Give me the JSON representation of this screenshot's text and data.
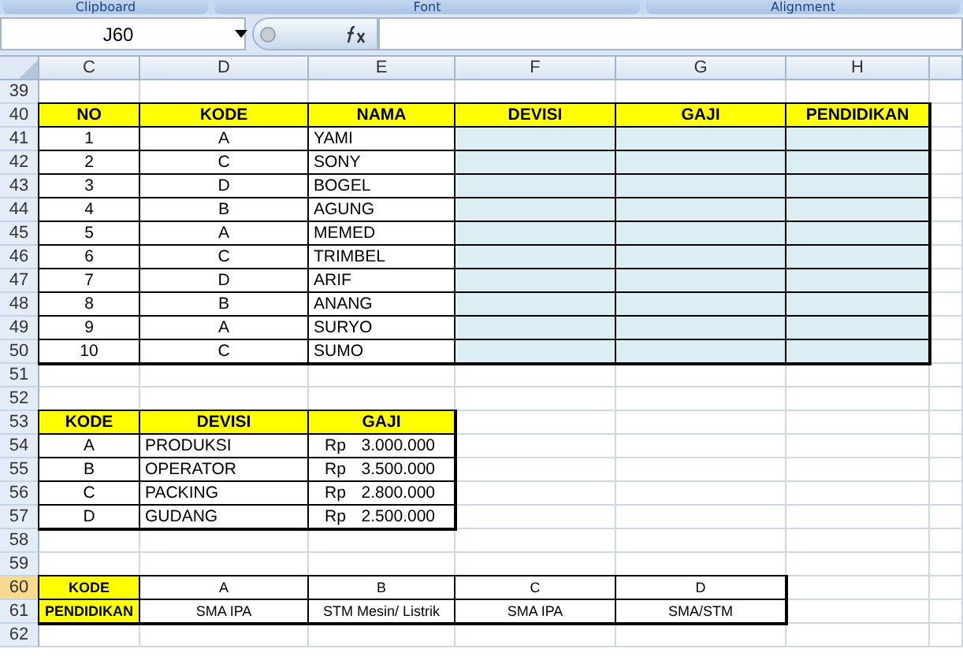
{
  "ribbon_groups": [
    "Clipboard",
    "Font",
    "Alignment"
  ],
  "name_box": "J60",
  "columns": [
    {
      "label": "C",
      "selected": false
    },
    {
      "label": "D",
      "selected": false
    },
    {
      "label": "E",
      "selected": false
    },
    {
      "label": "F",
      "selected": false
    },
    {
      "label": "G",
      "selected": false
    },
    {
      "label": "H",
      "selected": false
    }
  ],
  "rows": [
    {
      "number": "39",
      "selected": false,
      "cells": [
        {
          "kind": "blank"
        },
        {
          "kind": "blank"
        },
        {
          "kind": "blank"
        },
        {
          "kind": "blank"
        },
        {
          "kind": "blank"
        },
        {
          "kind": "blank"
        }
      ]
    },
    {
      "number": "40",
      "selected": false,
      "cells": [
        {
          "kind": "header",
          "text": "NO"
        },
        {
          "kind": "header",
          "text": "KODE"
        },
        {
          "kind": "header",
          "text": "NAMA"
        },
        {
          "kind": "header",
          "text": "DEVISI"
        },
        {
          "kind": "header",
          "text": "GAJI"
        },
        {
          "kind": "header",
          "text": "PENDIDIKAN"
        }
      ]
    },
    {
      "number": "41",
      "selected": false,
      "cells": [
        {
          "kind": "center",
          "text": "1"
        },
        {
          "kind": "center",
          "text": "A"
        },
        {
          "kind": "left",
          "text": "YAMI"
        },
        {
          "kind": "input"
        },
        {
          "kind": "input"
        },
        {
          "kind": "input"
        }
      ]
    },
    {
      "number": "42",
      "selected": false,
      "cells": [
        {
          "kind": "center",
          "text": "2"
        },
        {
          "kind": "center",
          "text": "C"
        },
        {
          "kind": "left",
          "text": "SONY"
        },
        {
          "kind": "input"
        },
        {
          "kind": "input"
        },
        {
          "kind": "input"
        }
      ]
    },
    {
      "number": "43",
      "selected": false,
      "cells": [
        {
          "kind": "center",
          "text": "3"
        },
        {
          "kind": "center",
          "text": "D"
        },
        {
          "kind": "left",
          "text": "BOGEL"
        },
        {
          "kind": "input"
        },
        {
          "kind": "input"
        },
        {
          "kind": "input"
        }
      ]
    },
    {
      "number": "44",
      "selected": false,
      "cells": [
        {
          "kind": "center",
          "text": "4"
        },
        {
          "kind": "center",
          "text": "B"
        },
        {
          "kind": "left",
          "text": "AGUNG"
        },
        {
          "kind": "input"
        },
        {
          "kind": "input"
        },
        {
          "kind": "input"
        }
      ]
    },
    {
      "number": "45",
      "selected": false,
      "cells": [
        {
          "kind": "center",
          "text": "5"
        },
        {
          "kind": "center",
          "text": "A"
        },
        {
          "kind": "left",
          "text": "MEMED"
        },
        {
          "kind": "input"
        },
        {
          "kind": "input"
        },
        {
          "kind": "input"
        }
      ]
    },
    {
      "number": "46",
      "selected": false,
      "cells": [
        {
          "kind": "center",
          "text": "6"
        },
        {
          "kind": "center",
          "text": "C"
        },
        {
          "kind": "left",
          "text": "TRIMBEL"
        },
        {
          "kind": "input"
        },
        {
          "kind": "input"
        },
        {
          "kind": "input"
        }
      ]
    },
    {
      "number": "47",
      "selected": false,
      "cells": [
        {
          "kind": "center",
          "text": "7"
        },
        {
          "kind": "center",
          "text": "D"
        },
        {
          "kind": "left",
          "text": "ARIF"
        },
        {
          "kind": "input"
        },
        {
          "kind": "input"
        },
        {
          "kind": "input"
        }
      ]
    },
    {
      "number": "48",
      "selected": false,
      "cells": [
        {
          "kind": "center",
          "text": "8"
        },
        {
          "kind": "center",
          "text": "B"
        },
        {
          "kind": "left",
          "text": "ANANG"
        },
        {
          "kind": "input"
        },
        {
          "kind": "input"
        },
        {
          "kind": "input"
        }
      ]
    },
    {
      "number": "49",
      "selected": false,
      "cells": [
        {
          "kind": "center",
          "text": "9"
        },
        {
          "kind": "center",
          "text": "A"
        },
        {
          "kind": "left",
          "text": "SURYO"
        },
        {
          "kind": "input"
        },
        {
          "kind": "input"
        },
        {
          "kind": "input"
        }
      ]
    },
    {
      "number": "50",
      "selected": false,
      "cells": [
        {
          "kind": "center",
          "text": "10"
        },
        {
          "kind": "center",
          "text": "C"
        },
        {
          "kind": "left",
          "text": "SUMO"
        },
        {
          "kind": "input"
        },
        {
          "kind": "input"
        },
        {
          "kind": "input"
        }
      ]
    },
    {
      "number": "51",
      "selected": false,
      "cells": [
        {
          "kind": "blank"
        },
        {
          "kind": "blank"
        },
        {
          "kind": "blank"
        },
        {
          "kind": "blank"
        },
        {
          "kind": "blank"
        },
        {
          "kind": "blank"
        }
      ]
    },
    {
      "number": "52",
      "selected": false,
      "cells": [
        {
          "kind": "blank"
        },
        {
          "kind": "blank"
        },
        {
          "kind": "blank"
        },
        {
          "kind": "blank"
        },
        {
          "kind": "blank"
        },
        {
          "kind": "blank"
        }
      ]
    },
    {
      "number": "53",
      "selected": false,
      "cells": [
        {
          "kind": "header",
          "text": "KODE"
        },
        {
          "kind": "header",
          "text": "DEVISI"
        },
        {
          "kind": "header",
          "text": "GAJI"
        },
        {
          "kind": "blank"
        },
        {
          "kind": "blank"
        },
        {
          "kind": "blank"
        }
      ]
    },
    {
      "number": "54",
      "selected": false,
      "cells": [
        {
          "kind": "center",
          "text": "A"
        },
        {
          "kind": "left",
          "text": "PRODUKSI"
        },
        {
          "kind": "money",
          "currency": "Rp",
          "amount": "3.000.000"
        },
        {
          "kind": "blank"
        },
        {
          "kind": "blank"
        },
        {
          "kind": "blank"
        }
      ]
    },
    {
      "number": "55",
      "selected": false,
      "cells": [
        {
          "kind": "center",
          "text": "B"
        },
        {
          "kind": "left",
          "text": "OPERATOR"
        },
        {
          "kind": "money",
          "currency": "Rp",
          "amount": "3.500.000"
        },
        {
          "kind": "blank"
        },
        {
          "kind": "blank"
        },
        {
          "kind": "blank"
        }
      ]
    },
    {
      "number": "56",
      "selected": false,
      "cells": [
        {
          "kind": "center",
          "text": "C"
        },
        {
          "kind": "left",
          "text": "PACKING"
        },
        {
          "kind": "money",
          "currency": "Rp",
          "amount": "2.800.000"
        },
        {
          "kind": "blank"
        },
        {
          "kind": "blank"
        },
        {
          "kind": "blank"
        }
      ]
    },
    {
      "number": "57",
      "selected": false,
      "cells": [
        {
          "kind": "center",
          "text": "D"
        },
        {
          "kind": "left",
          "text": "GUDANG"
        },
        {
          "kind": "money",
          "currency": "Rp",
          "amount": "2.500.000"
        },
        {
          "kind": "blank"
        },
        {
          "kind": "blank"
        },
        {
          "kind": "blank"
        }
      ]
    },
    {
      "number": "58",
      "selected": false,
      "cells": [
        {
          "kind": "blank"
        },
        {
          "kind": "blank"
        },
        {
          "kind": "blank"
        },
        {
          "kind": "blank"
        },
        {
          "kind": "blank"
        },
        {
          "kind": "blank"
        }
      ]
    },
    {
      "number": "59",
      "selected": false,
      "cells": [
        {
          "kind": "blank"
        },
        {
          "kind": "blank"
        },
        {
          "kind": "blank"
        },
        {
          "kind": "blank"
        },
        {
          "kind": "blank"
        },
        {
          "kind": "blank"
        }
      ]
    },
    {
      "number": "60",
      "selected": true,
      "cells": [
        {
          "kind": "header_small",
          "text": "KODE"
        },
        {
          "kind": "small",
          "text": "A"
        },
        {
          "kind": "small",
          "text": "B"
        },
        {
          "kind": "small",
          "text": "C"
        },
        {
          "kind": "small",
          "text": "D"
        },
        {
          "kind": "blank"
        }
      ]
    },
    {
      "number": "61",
      "selected": false,
      "cells": [
        {
          "kind": "header_small",
          "text": "PENDIDIKAN"
        },
        {
          "kind": "small",
          "text": "SMA IPA"
        },
        {
          "kind": "small",
          "text": "STM Mesin/ Listrik"
        },
        {
          "kind": "small",
          "text": "SMA IPA"
        },
        {
          "kind": "small",
          "text": "SMA/STM"
        },
        {
          "kind": "blank"
        }
      ]
    },
    {
      "number": "62",
      "selected": false,
      "cells": [
        {
          "kind": "blank"
        },
        {
          "kind": "blank"
        },
        {
          "kind": "blank"
        },
        {
          "kind": "blank"
        },
        {
          "kind": "blank"
        },
        {
          "kind": "blank"
        }
      ]
    }
  ]
}
